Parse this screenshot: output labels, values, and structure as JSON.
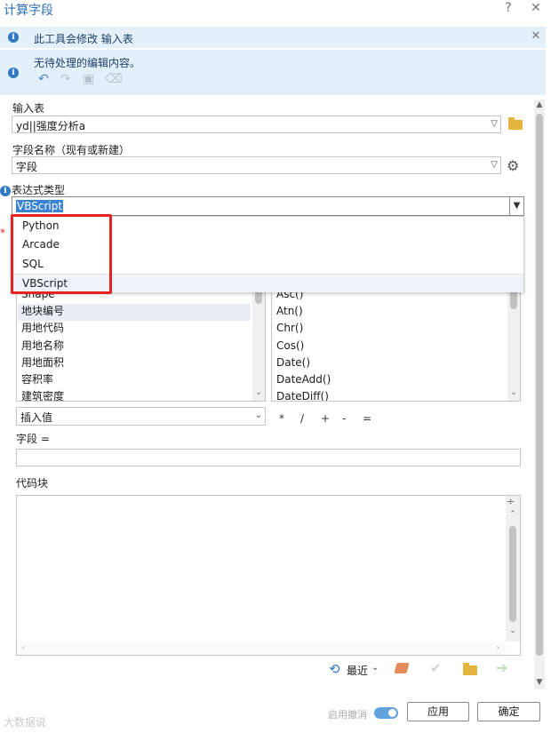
{
  "window": {
    "title": "计算字段",
    "help_label": "?",
    "close_label": "✕"
  },
  "info_bar_1": {
    "text": "此工具会修改 输入表",
    "close_label": "✕"
  },
  "info_bar_2": {
    "text": "无待处理的编辑内容。"
  },
  "input_table": {
    "label": "输入表",
    "value": "yd||强度分析a"
  },
  "field_name": {
    "label": "字段名称（现有或新建）",
    "value": "字段"
  },
  "expression_type": {
    "label": "表达式类型",
    "value": "VBScript",
    "options": [
      "Python",
      "Arcade",
      "SQL",
      "VBScript"
    ]
  },
  "fields_list": {
    "items": [
      "Shape",
      "地块编号",
      "用地代码",
      "用地名称",
      "用地面积",
      "容积率",
      "建筑密度"
    ]
  },
  "functions_list": {
    "items": [
      "Asc()",
      "Atn()",
      "Chr()",
      "Cos()",
      "Date()",
      "DateAdd()",
      "DateDiff()"
    ]
  },
  "insert_values": {
    "value": "插入值"
  },
  "operators": [
    "*",
    "/",
    "+",
    "-",
    "="
  ],
  "expression": {
    "label": "字段 =",
    "value": ""
  },
  "code_block": {
    "label": "代码块",
    "value": ""
  },
  "recent": {
    "label": "最近"
  },
  "footer": {
    "watermark": "大数据说",
    "undo_toggle_label": "启用撤消",
    "apply_label": "应用",
    "ok_label": "确定"
  },
  "colors": {
    "title": "#2d6fb5",
    "info_bar": "#e3f0fa",
    "highlight_box": "#e52323",
    "selection": "#3a83d3"
  }
}
